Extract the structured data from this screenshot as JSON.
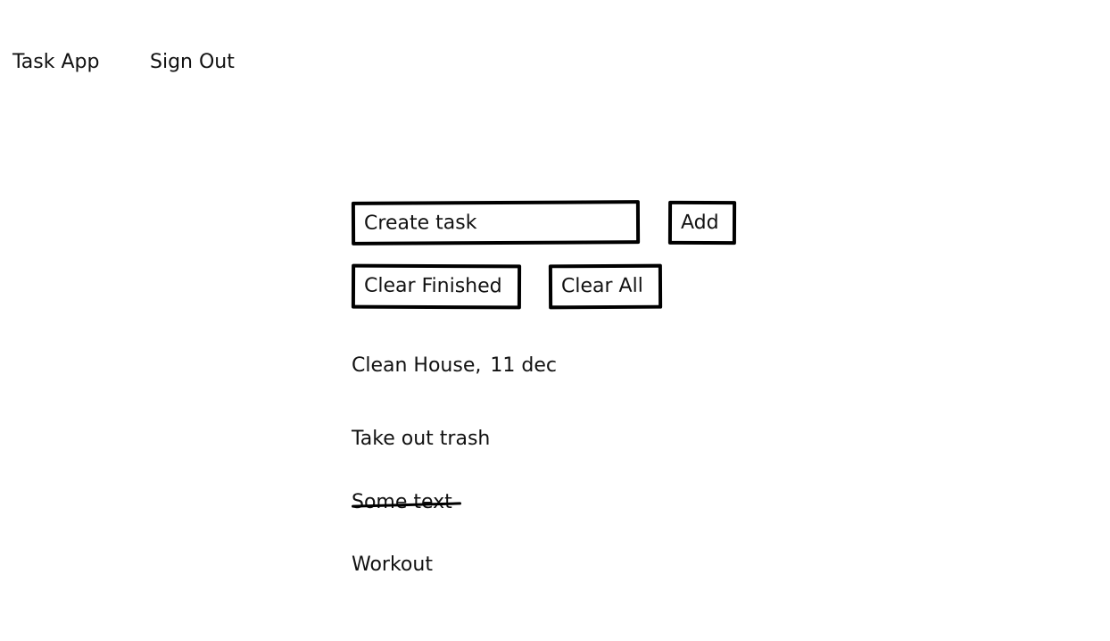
{
  "header": {
    "app_title": "Task App",
    "sign_out_label": "Sign Out"
  },
  "form": {
    "task_placeholder": "Create task",
    "task_value": "",
    "add_label": "Add",
    "clear_finished_label": "Clear Finished",
    "clear_all_label": "Clear All"
  },
  "tasks": [
    {
      "title": "Clean House,",
      "date": "11 dec",
      "done": false
    },
    {
      "title": "Take out trash",
      "date": "",
      "done": false
    },
    {
      "title": "Some text",
      "date": "",
      "done": true
    },
    {
      "title": "Workout",
      "date": "",
      "done": false
    }
  ]
}
